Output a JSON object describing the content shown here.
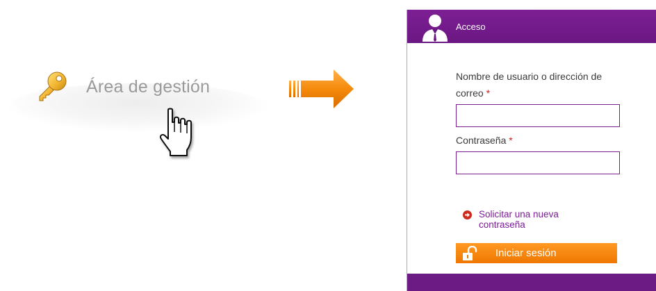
{
  "menu": {
    "item_label": "Área de gestión",
    "icon": "key-icon"
  },
  "cursor": {
    "icon": "hand-pointer-cursor"
  },
  "arrow": {
    "icon": "arrow-right-icon",
    "color": "#f08a1a"
  },
  "login_panel": {
    "title": "Acceso",
    "header_icon": "user-icon",
    "header_color": "#751b8c",
    "username_label": "Nombre de usuario o dirección de correo",
    "username_required_mark": "*",
    "username_value": "",
    "password_label": "Contraseña",
    "password_required_mark": "*",
    "password_value": "",
    "forgot_link": "Solicitar una nueva contraseña",
    "forgot_icon": "arrow-circle-right-icon",
    "submit_label": "Iniciar sesión",
    "submit_icon": "unlocked-padlock-icon",
    "submit_color": "#f58a0b"
  }
}
